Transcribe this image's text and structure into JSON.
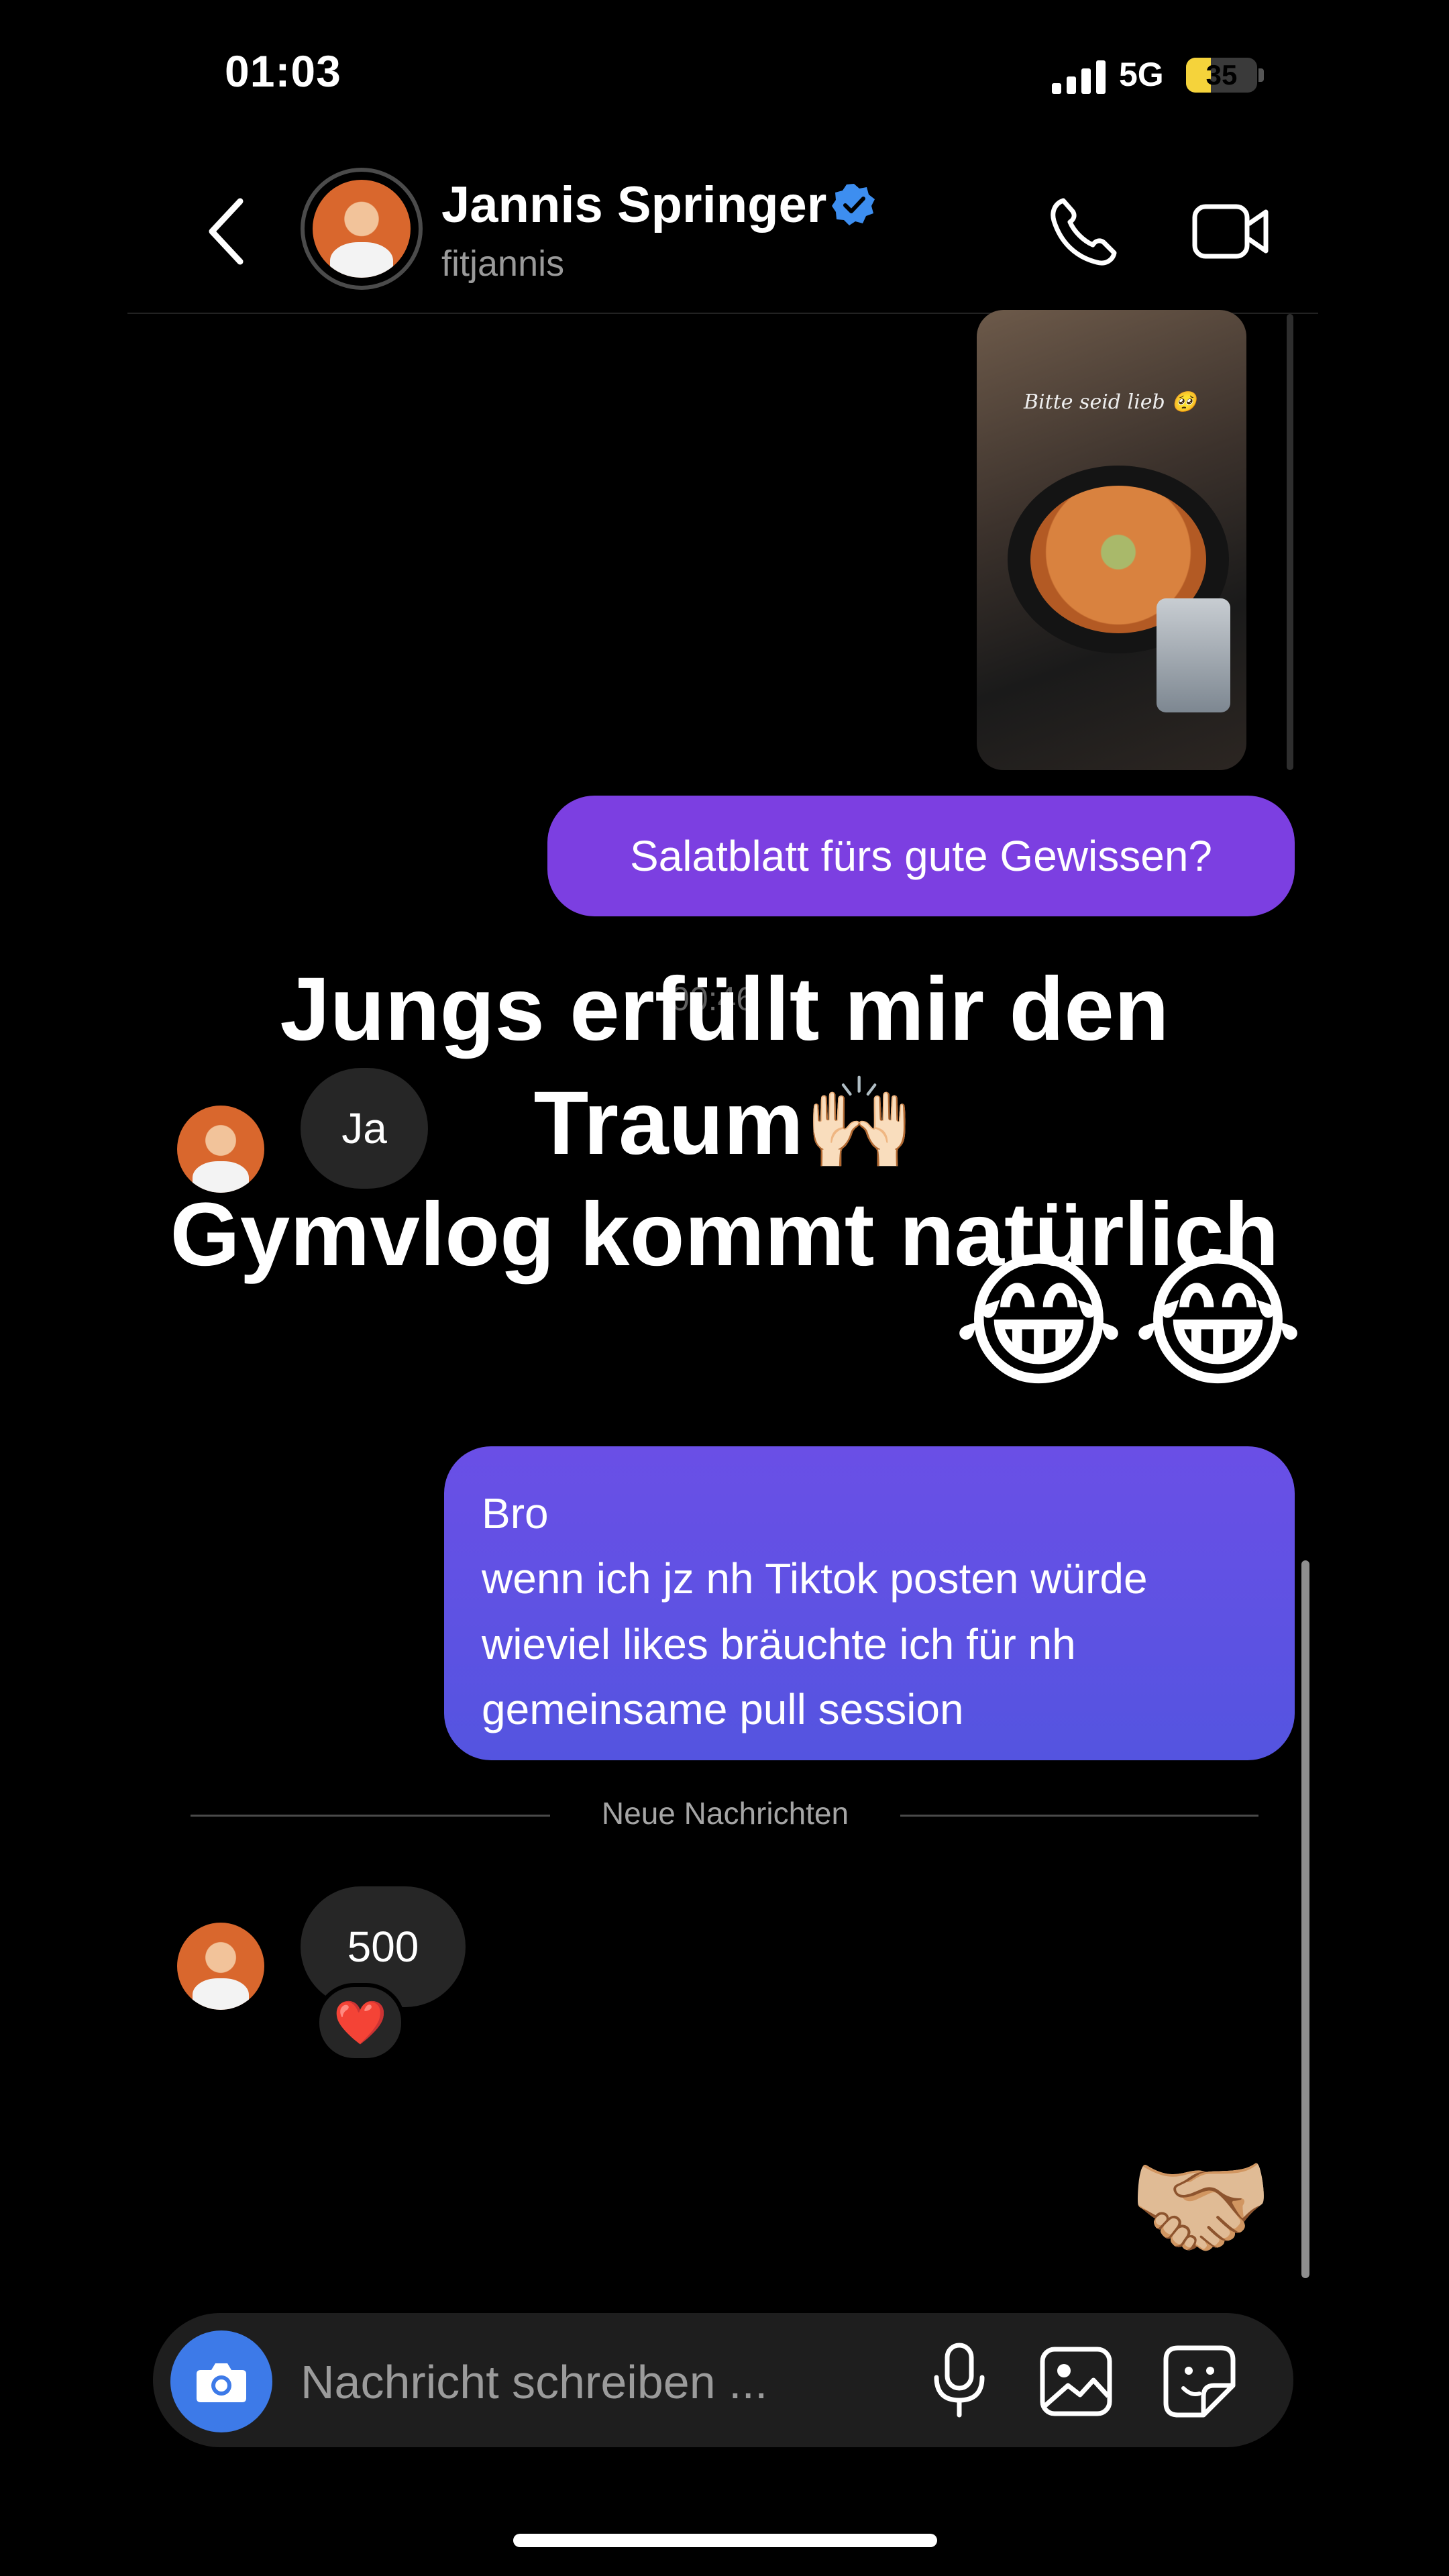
{
  "status_bar": {
    "time": "01:03",
    "network": "5G",
    "battery": "35",
    "battery_level_percent": 35,
    "battery_color": "#f5d33b"
  },
  "header": {
    "name": "Jannis Springer",
    "username": "fitjannis",
    "verified": true,
    "icons": [
      "back-arrow-icon",
      "verified-badge-icon",
      "phone-icon",
      "video-camera-icon"
    ]
  },
  "shared_story": {
    "caption": "Bitte seid lieb 🥺"
  },
  "messages": {
    "outgoing_1": "Salatblatt fürs gute Gewissen?",
    "incoming_ja": "Ja",
    "overlay_line_1": "Jungs erfüllt mir den",
    "overlay_line_2": "Traum🙌🏻",
    "overlay_line_3": "Gymvlog kommt natürlich",
    "overlay_emojis": "😂😂",
    "faded_time": "00:46",
    "outgoing_2": "Bro\nwenn ich jz nh Tiktok posten würde\nwieviel likes bräuchte ich für nh\ngemeinsame pull session",
    "new_messages_label": "Neue Nachrichten",
    "incoming_500": "500",
    "reaction": "❤️",
    "handshake": "🤝🏼"
  },
  "composer": {
    "placeholder": "Nachricht schreiben ...",
    "icons": [
      "camera-icon",
      "microphone-icon",
      "gallery-icon",
      "sticker-icon"
    ]
  },
  "colors": {
    "accent_purple": "#7c3fe1",
    "accent_indigo": "#5454e0",
    "verified_blue": "#3d8ef0",
    "camera_button_blue": "#3d7ae8"
  }
}
